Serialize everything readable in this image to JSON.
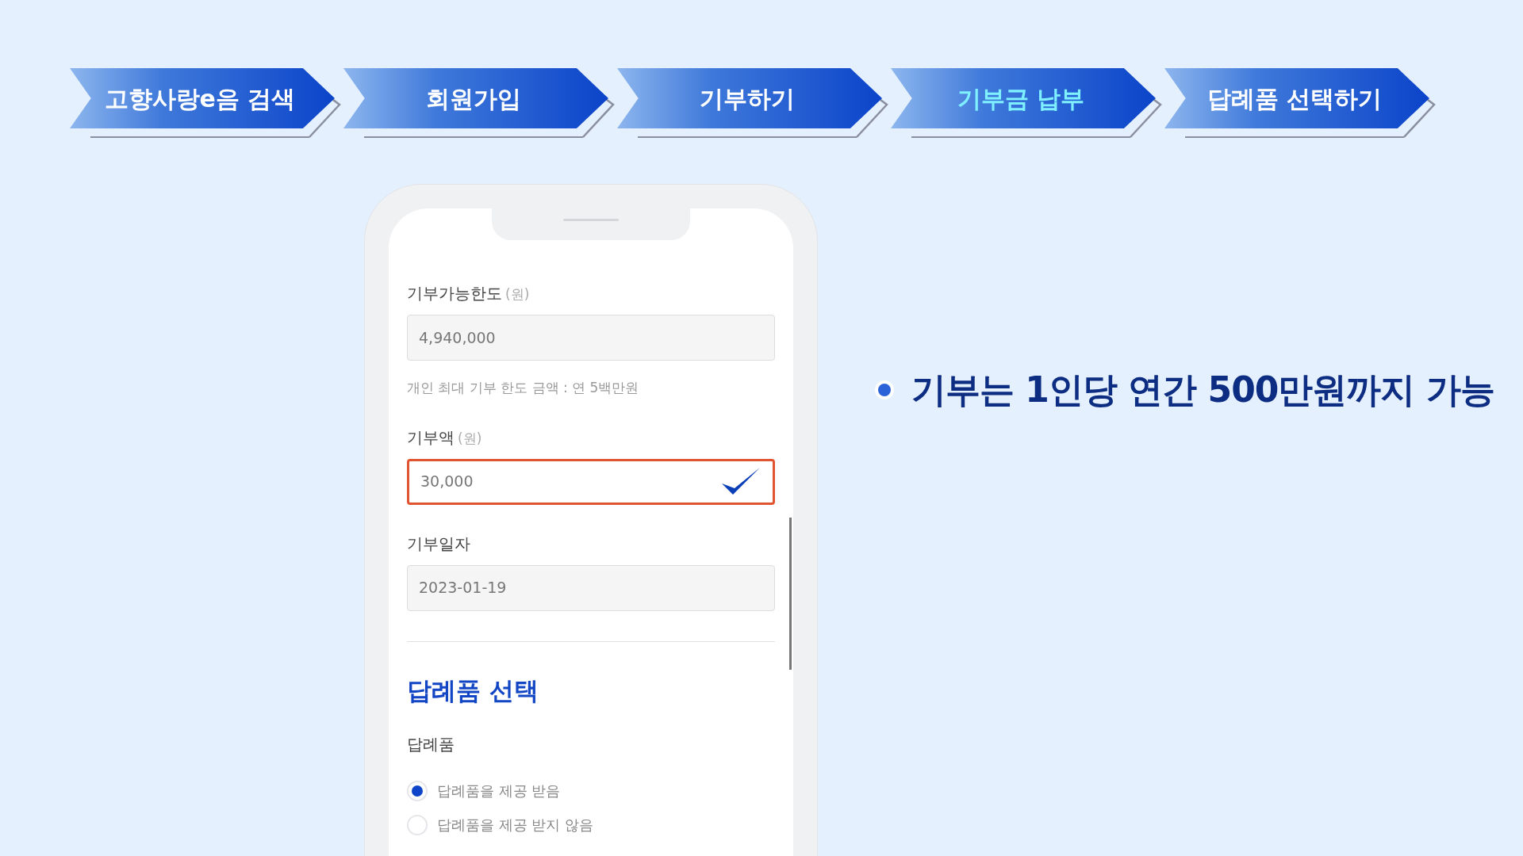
{
  "steps": [
    {
      "label": "고향사랑e음 검색",
      "selected": false
    },
    {
      "label": "회원가입",
      "selected": false
    },
    {
      "label": "기부하기",
      "selected": false
    },
    {
      "label": "기부금 납부",
      "selected": true
    },
    {
      "label": "답례품 선택하기",
      "selected": false
    }
  ],
  "form": {
    "fields": [
      {
        "label": "기부가능한도",
        "unit": "(원)",
        "value": "4,940,000",
        "kind": "readonly",
        "hint": "개인 최대 기부 한도 금액 : 연 5백만원"
      },
      {
        "label": "기부액",
        "unit": "(원)",
        "value": "30,000",
        "kind": "confirmed"
      },
      {
        "label": "기부일자",
        "value": "2023-01-19",
        "kind": "readonly"
      }
    ],
    "section_title": "답례품 선택",
    "gift_label": "답례품",
    "options": [
      {
        "label": "답례품을 제공 받음",
        "selected": true
      },
      {
        "label": "답례품을 제공 받지 않음",
        "selected": false
      }
    ]
  },
  "bullet": "기부는 1인당 연간 500만원까지 가능"
}
